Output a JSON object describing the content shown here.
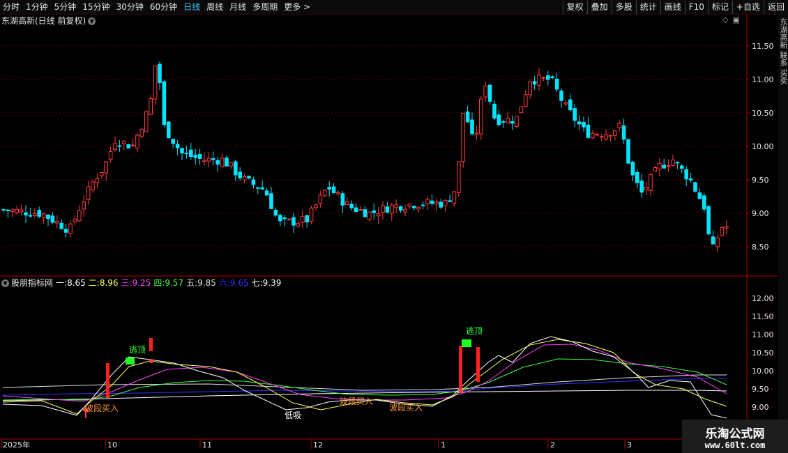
{
  "toolbar": {
    "periods": [
      "分时",
      "1分钟",
      "5分钟",
      "15分钟",
      "30分钟",
      "60分钟",
      "日线",
      "周线",
      "月线",
      "多周期",
      "更多 >"
    ],
    "active_period": "日线",
    "tools": [
      "复权",
      "叠加",
      "多股",
      "统计",
      "画线",
      "F10",
      "标记",
      "+自选",
      "返回"
    ]
  },
  "main_panel": {
    "title": "东湖高新(日线 前复权)",
    "price_ticks": [
      "11.50",
      "11.00",
      "10.50",
      "10.00",
      "9.50",
      "9.00",
      "8.50"
    ],
    "colors": {
      "up": "#ff3b3b",
      "down": "#00e5ff"
    }
  },
  "indicator_panel": {
    "name": "股朋指标网",
    "values": [
      {
        "label": "一:",
        "value": "8.65",
        "color": "#ffffff"
      },
      {
        "label": "二:",
        "value": "8.96",
        "color": "#ffff55"
      },
      {
        "label": "三:",
        "value": "9.25",
        "color": "#ff44ff"
      },
      {
        "label": "四:",
        "value": "9.57",
        "color": "#44ff44"
      },
      {
        "label": "五:",
        "value": "9.85",
        "color": "#dddddd"
      },
      {
        "label": "六:",
        "value": "9.65",
        "color": "#3333ff"
      },
      {
        "label": "七:",
        "value": "9.39",
        "color": "#ffffff"
      }
    ],
    "price_ticks": [
      "12.00",
      "11.50",
      "11.00",
      "10.50",
      "10.00",
      "9.50",
      "9.00"
    ],
    "annotations": [
      "逃顶",
      "逃顶",
      "波段买入",
      "低吸",
      "波段买入",
      "波段买入"
    ]
  },
  "date_axis": [
    "2025年",
    "10",
    "11",
    "12",
    "1",
    "2",
    "3"
  ],
  "side_strip": "东湖高新 联系 买卖",
  "watermark": {
    "title": "乐淘公式网",
    "url": "www.60lt.com"
  }
}
